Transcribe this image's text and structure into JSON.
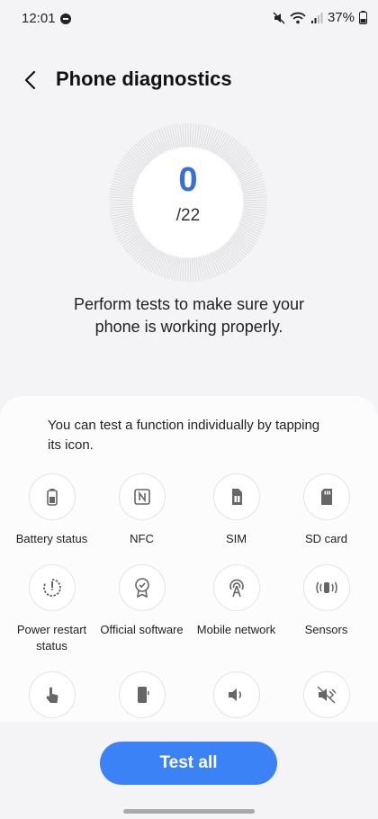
{
  "status_bar": {
    "time": "12:01",
    "battery": "37%",
    "icons": [
      "do-not-disturb-icon",
      "mute-icon",
      "wifi-icon",
      "signal-icon",
      "battery-icon"
    ]
  },
  "header": {
    "title": "Phone diagnostics",
    "back_icon": "back-arrow-icon"
  },
  "progress": {
    "done": "0",
    "total": "/22"
  },
  "description": "Perform tests to make sure your phone is working properly.",
  "card": {
    "hint": "You can test a function individually by tapping its icon.",
    "items": [
      {
        "label": "Battery status",
        "icon": "battery-icon"
      },
      {
        "label": "NFC",
        "icon": "nfc-icon"
      },
      {
        "label": "SIM",
        "icon": "sim-icon"
      },
      {
        "label": "SD card",
        "icon": "sd-card-icon"
      },
      {
        "label": "Power restart status",
        "icon": "power-restart-icon"
      },
      {
        "label": "Official software",
        "icon": "official-software-icon"
      },
      {
        "label": "Mobile network",
        "icon": "mobile-network-icon"
      },
      {
        "label": "Sensors",
        "icon": "sensors-icon"
      },
      {
        "label": "",
        "icon": "touch-icon"
      },
      {
        "label": "",
        "icon": "screen-icon"
      },
      {
        "label": "",
        "icon": "speaker-icon"
      },
      {
        "label": "",
        "icon": "vibration-icon"
      }
    ]
  },
  "footer": {
    "test_all_label": "Test all"
  },
  "colors": {
    "accent": "#3b82f6",
    "count": "#3a6fd6",
    "background": "#f4f4f6"
  }
}
